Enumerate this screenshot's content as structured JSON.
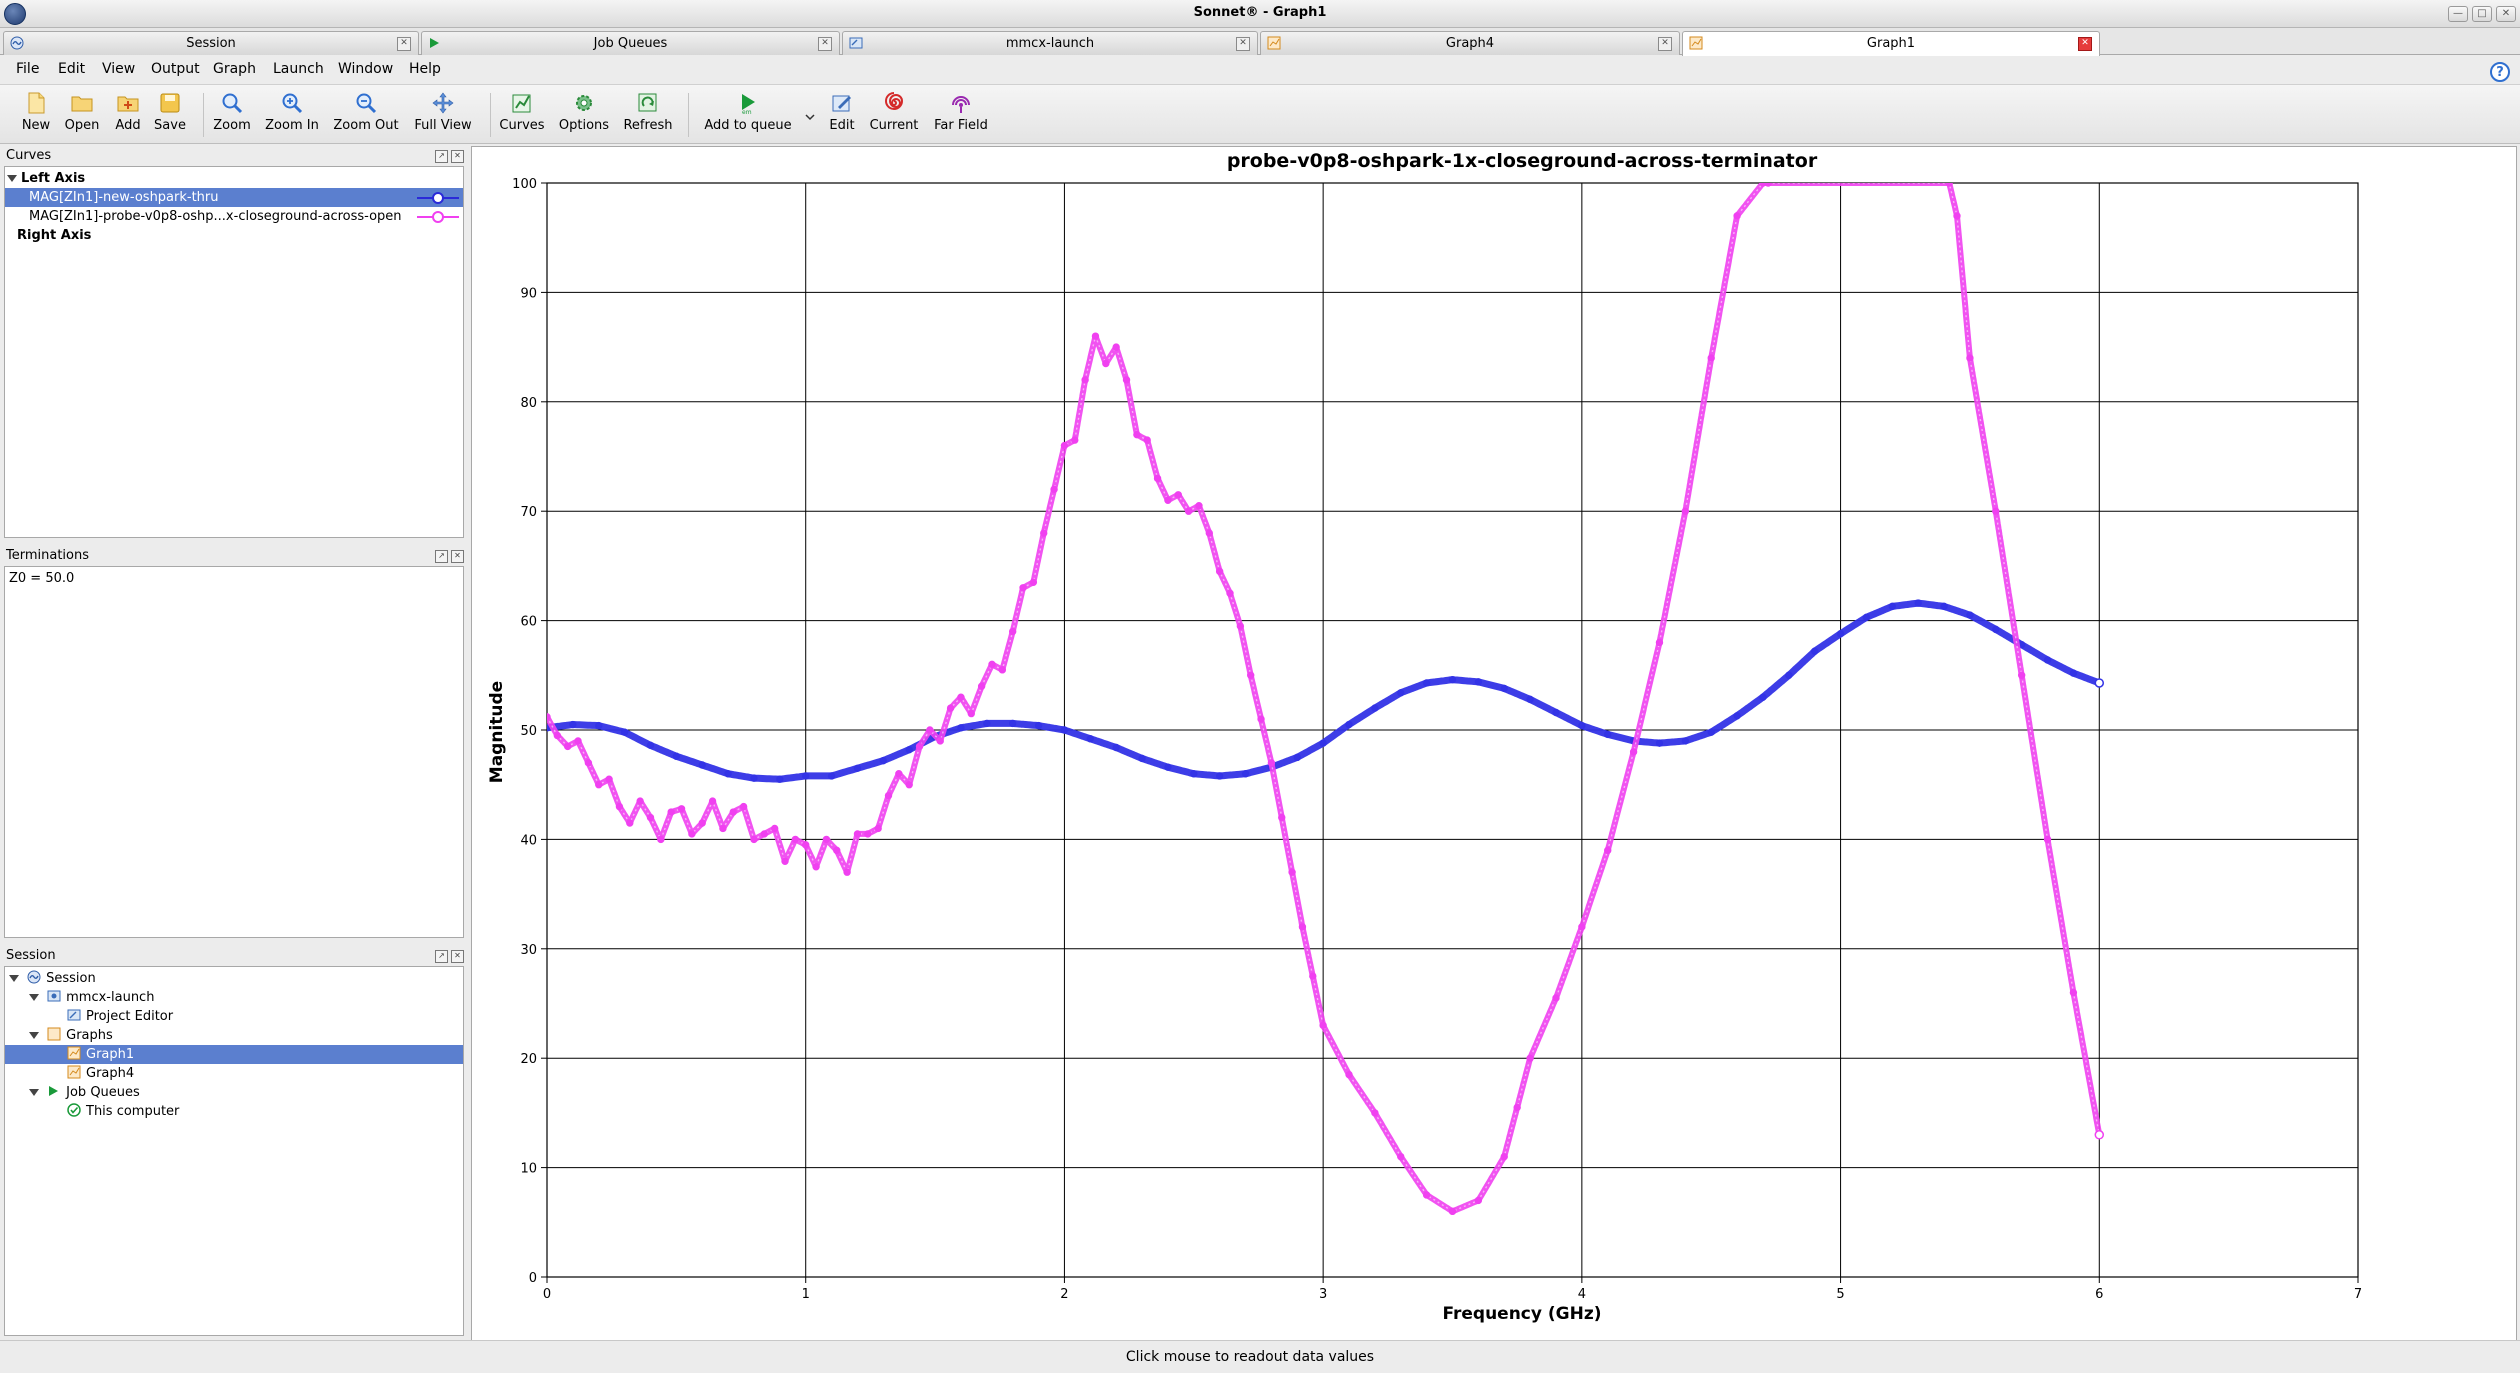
{
  "window": {
    "title": "Sonnet® - Graph1"
  },
  "tabs": [
    {
      "label": "Session"
    },
    {
      "label": "Job Queues"
    },
    {
      "label": "mmcx-launch"
    },
    {
      "label": "Graph4"
    },
    {
      "label": "Graph1"
    }
  ],
  "menu": [
    "File",
    "Edit",
    "View",
    "Output",
    "Graph",
    "Launch",
    "Window",
    "Help"
  ],
  "toolbar": {
    "new": "New",
    "open": "Open",
    "add": "Add",
    "save": "Save",
    "zoom": "Zoom",
    "zoom_in": "Zoom In",
    "zoom_out": "Zoom Out",
    "full_view": "Full View",
    "curves": "Curves",
    "options": "Options",
    "refresh": "Refresh",
    "add_to_queue": "Add to queue",
    "edit": "Edit",
    "current": "Current",
    "far_field": "Far Field"
  },
  "curves_panel": {
    "title": "Curves",
    "left_axis": "Left Axis",
    "curve1": "MAG[ZIn1]-new-oshpark-thru",
    "curve2": "MAG[ZIn1]-probe-v0p8-oshp...x-closeground-across-open",
    "right_axis": "Right Axis"
  },
  "terminations_panel": {
    "title": "Terminations",
    "z0": "Z0 = 50.0"
  },
  "session_panel": {
    "title": "Session",
    "items": [
      "Session",
      "mmcx-launch",
      "Project Editor",
      "Graphs",
      "Graph1",
      "Graph4",
      "Job Queues",
      "This computer"
    ]
  },
  "status": "Click mouse to readout data values",
  "colors": {
    "series1": "#3333e6",
    "series2": "#f040f0",
    "selection": "#5b7fcf"
  },
  "chart_data": {
    "type": "line",
    "title": "probe-v0p8-oshpark-1x-closeground-across-terminator",
    "xlabel": "Frequency (GHz)",
    "ylabel": "Magnitude",
    "xlim": [
      0,
      7
    ],
    "ylim": [
      0,
      100
    ],
    "xticks": [
      0,
      1,
      2,
      3,
      4,
      5,
      6,
      7
    ],
    "yticks": [
      0,
      10,
      20,
      30,
      40,
      50,
      60,
      70,
      80,
      90,
      100
    ],
    "grid": true,
    "series": [
      {
        "name": "MAG[ZIn1]-new-oshpark-thru",
        "color": "#3333e6",
        "x": [
          0,
          0.1,
          0.2,
          0.3,
          0.4,
          0.5,
          0.6,
          0.7,
          0.8,
          0.9,
          1.0,
          1.1,
          1.2,
          1.3,
          1.4,
          1.5,
          1.6,
          1.7,
          1.8,
          1.9,
          2.0,
          2.1,
          2.2,
          2.3,
          2.4,
          2.5,
          2.6,
          2.7,
          2.8,
          2.9,
          3.0,
          3.1,
          3.2,
          3.3,
          3.4,
          3.5,
          3.6,
          3.7,
          3.8,
          3.9,
          4.0,
          4.1,
          4.2,
          4.3,
          4.4,
          4.5,
          4.6,
          4.7,
          4.8,
          4.9,
          5.0,
          5.1,
          5.2,
          5.3,
          5.4,
          5.5,
          5.6,
          5.7,
          5.8,
          5.9,
          6.0
        ],
        "y": [
          50.2,
          50.5,
          50.4,
          49.8,
          48.6,
          47.6,
          46.8,
          46.0,
          45.6,
          45.5,
          45.8,
          45.8,
          46.5,
          47.2,
          48.2,
          49.4,
          50.2,
          50.6,
          50.6,
          50.4,
          50.0,
          49.2,
          48.4,
          47.4,
          46.6,
          46.0,
          45.8,
          46.0,
          46.6,
          47.5,
          48.8,
          50.5,
          52.0,
          53.4,
          54.3,
          54.6,
          54.4,
          53.8,
          52.8,
          51.6,
          50.4,
          49.6,
          49.0,
          48.8,
          49.0,
          49.8,
          51.3,
          53.0,
          55.0,
          57.2,
          58.8,
          60.3,
          61.3,
          61.6,
          61.3,
          60.5,
          59.2,
          57.8,
          56.4,
          55.2,
          54.3
        ]
      },
      {
        "name": "MAG[ZIn1]-probe-v0p8-oshp...x-closeground-across-open",
        "color": "#f040f0",
        "x": [
          0,
          0.04,
          0.08,
          0.12,
          0.16,
          0.2,
          0.24,
          0.28,
          0.32,
          0.36,
          0.4,
          0.44,
          0.48,
          0.52,
          0.56,
          0.6,
          0.64,
          0.68,
          0.72,
          0.76,
          0.8,
          0.84,
          0.88,
          0.92,
          0.96,
          1.0,
          1.04,
          1.08,
          1.12,
          1.16,
          1.2,
          1.24,
          1.28,
          1.32,
          1.36,
          1.4,
          1.44,
          1.48,
          1.52,
          1.56,
          1.6,
          1.64,
          1.68,
          1.72,
          1.76,
          1.8,
          1.84,
          1.88,
          1.92,
          1.96,
          2.0,
          2.04,
          2.08,
          2.12,
          2.16,
          2.2,
          2.24,
          2.28,
          2.32,
          2.36,
          2.4,
          2.44,
          2.48,
          2.52,
          2.56,
          2.6,
          2.64,
          2.68,
          2.72,
          2.76,
          2.8,
          2.84,
          2.88,
          2.92,
          2.96,
          3.0,
          3.1,
          3.2,
          3.3,
          3.4,
          3.5,
          3.6,
          3.7,
          3.75,
          3.8,
          3.9,
          4.0,
          4.1,
          4.2,
          4.3,
          4.4,
          4.5,
          4.6,
          4.7,
          4.72,
          5.42,
          5.45,
          5.5,
          5.6,
          5.7,
          5.8,
          5.9,
          6.0
        ],
        "y": [
          51.2,
          49.5,
          48.5,
          49.0,
          47.0,
          45.0,
          45.5,
          43.0,
          41.5,
          43.5,
          42.0,
          40.0,
          42.5,
          42.8,
          40.5,
          41.5,
          43.5,
          41.0,
          42.5,
          43.0,
          40.0,
          40.5,
          41.0,
          38.0,
          40.0,
          39.5,
          37.5,
          40.0,
          39.0,
          37.0,
          40.5,
          40.5,
          41.0,
          44.0,
          46.0,
          45.0,
          48.5,
          50.0,
          49.0,
          52.0,
          53.0,
          51.5,
          54.0,
          56.0,
          55.5,
          59.0,
          63.0,
          63.5,
          68.0,
          72.0,
          76.0,
          76.5,
          82.0,
          86.0,
          83.5,
          85.0,
          82.0,
          77.0,
          76.5,
          73.0,
          71.0,
          71.5,
          70.0,
          70.5,
          68.0,
          64.5,
          62.5,
          59.5,
          55.0,
          51.0,
          47.0,
          42.0,
          37.0,
          32.0,
          27.5,
          23.0,
          18.5,
          15.0,
          11.0,
          7.5,
          6.0,
          7.0,
          11.0,
          15.5,
          20.0,
          25.5,
          32.0,
          39.0,
          48.0,
          58.0,
          70.0,
          84.0,
          97.0,
          100,
          100,
          100,
          97.0,
          84.0,
          70.0,
          55.0,
          40.0,
          26.0,
          13.0
        ]
      }
    ]
  }
}
